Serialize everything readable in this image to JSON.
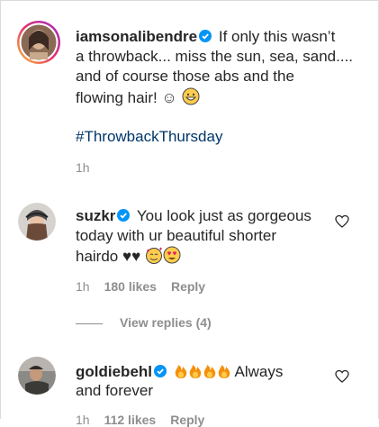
{
  "comments": [
    {
      "username": "iamsonalibendre",
      "verified": true,
      "lines": [
        "If only this wasn’t",
        "a throwback... miss the sun, sea, sand....",
        "and of course those abs and the",
        "flowing hair! ☺"
      ],
      "hashtag": "#ThrowbackThursday",
      "time": "1h"
    },
    {
      "username": "suzkr",
      "verified": true,
      "lines": [
        "You look just as gorgeous",
        "today with ur beautiful shorter",
        "hairdo ♥♥"
      ],
      "time": "1h",
      "likes": "180 likes",
      "reply": "Reply"
    },
    {
      "username": "goldiebehl",
      "verified": true,
      "lines": [
        "Always",
        "and forever"
      ],
      "time": "1h",
      "likes": "112 likes",
      "reply": "Reply"
    }
  ],
  "view_replies": "View replies (4)",
  "colors": {
    "hashtag": "#00376b",
    "meta": "#8e8e8e",
    "verified": "#0095f6",
    "heart": "#262626"
  }
}
